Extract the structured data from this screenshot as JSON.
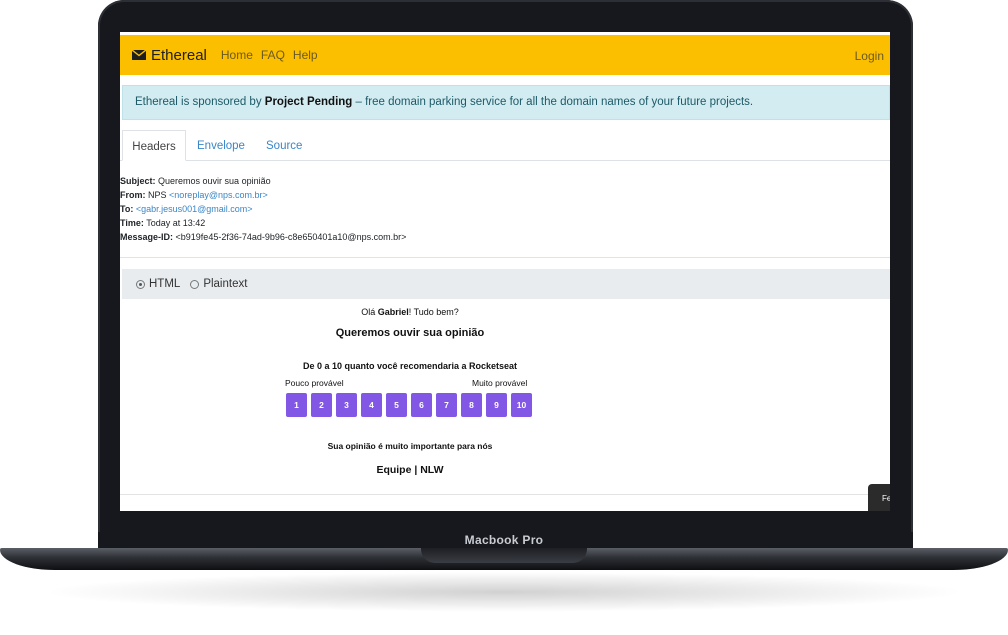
{
  "device": {
    "label": "Macbook Pro"
  },
  "navbar": {
    "brand": "Ethereal",
    "links": [
      "Home",
      "FAQ",
      "Help"
    ],
    "login": "Login",
    "accent": "#fcbf00"
  },
  "sponsor": {
    "prefix": "Ethereal is sponsored by ",
    "name": "Project Pending",
    "suffix": " – free domain parking service for all the domain names of your future projects."
  },
  "tabs": [
    "Headers",
    "Envelope",
    "Source"
  ],
  "message": {
    "subject_label": "Subject:",
    "subject": "Queremos ouvir sua opinião",
    "from_label": "From:",
    "from_name": "NPS",
    "from_email": "<noreplay@nps.com.br>",
    "to_label": "To:",
    "to_email": "<gabr.jesus001@gmail.com>",
    "time_label": "Time:",
    "time": "Today at 13:42",
    "id_label": "Message-ID:",
    "id": "<b919fe45-2f36-74ad-9b96-c8e650401a10@nps.com.br>"
  },
  "format": {
    "options": [
      "HTML",
      "Plaintext"
    ],
    "selected": "HTML"
  },
  "email_body": {
    "greeting_prefix": "Olá ",
    "greeting_name": "Gabriel",
    "greeting_suffix": "! Tudo bem?",
    "title": "Queremos ouvir sua opinião",
    "question": "De 0 a 10 quanto você recomendaria a Rocketseat",
    "low_label": "Pouco provável",
    "high_label": "Muito provável",
    "scores": [
      "1",
      "2",
      "3",
      "4",
      "5",
      "6",
      "7",
      "8",
      "9",
      "10"
    ],
    "button_color": "#8257e5",
    "importance": "Sua opinião é muito importante para nós",
    "signature": "Equipe | NLW"
  },
  "corner_button": {
    "label": "Fe"
  }
}
